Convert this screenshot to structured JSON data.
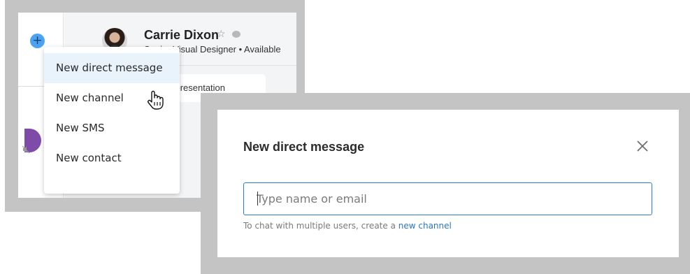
{
  "contact": {
    "name": "Carrie Dixon",
    "status": "Senior Visual Designer • Available"
  },
  "message_preview": "for the presentation",
  "new_menu": {
    "items": [
      {
        "label": "New direct message",
        "active": true
      },
      {
        "label": "New channel",
        "active": false
      },
      {
        "label": "New SMS",
        "active": false
      },
      {
        "label": "New contact",
        "active": false
      }
    ]
  },
  "modal": {
    "title": "New direct message",
    "input_placeholder": "Type name or email",
    "input_value": "",
    "helper_text": "To chat with multiple users, create a ",
    "helper_link": "new channel"
  },
  "icons": [
    "plus-icon",
    "star-icon",
    "chat-bubble-icon",
    "mute-icon",
    "hand-cursor-icon",
    "close-icon"
  ],
  "colors": {
    "accent": "#2f7fc1",
    "plus_button": "#4aa3f2",
    "menu_active": "#e9f3fb",
    "frame_gray": "#c4c4c4",
    "presence_available": "#4caf50"
  }
}
